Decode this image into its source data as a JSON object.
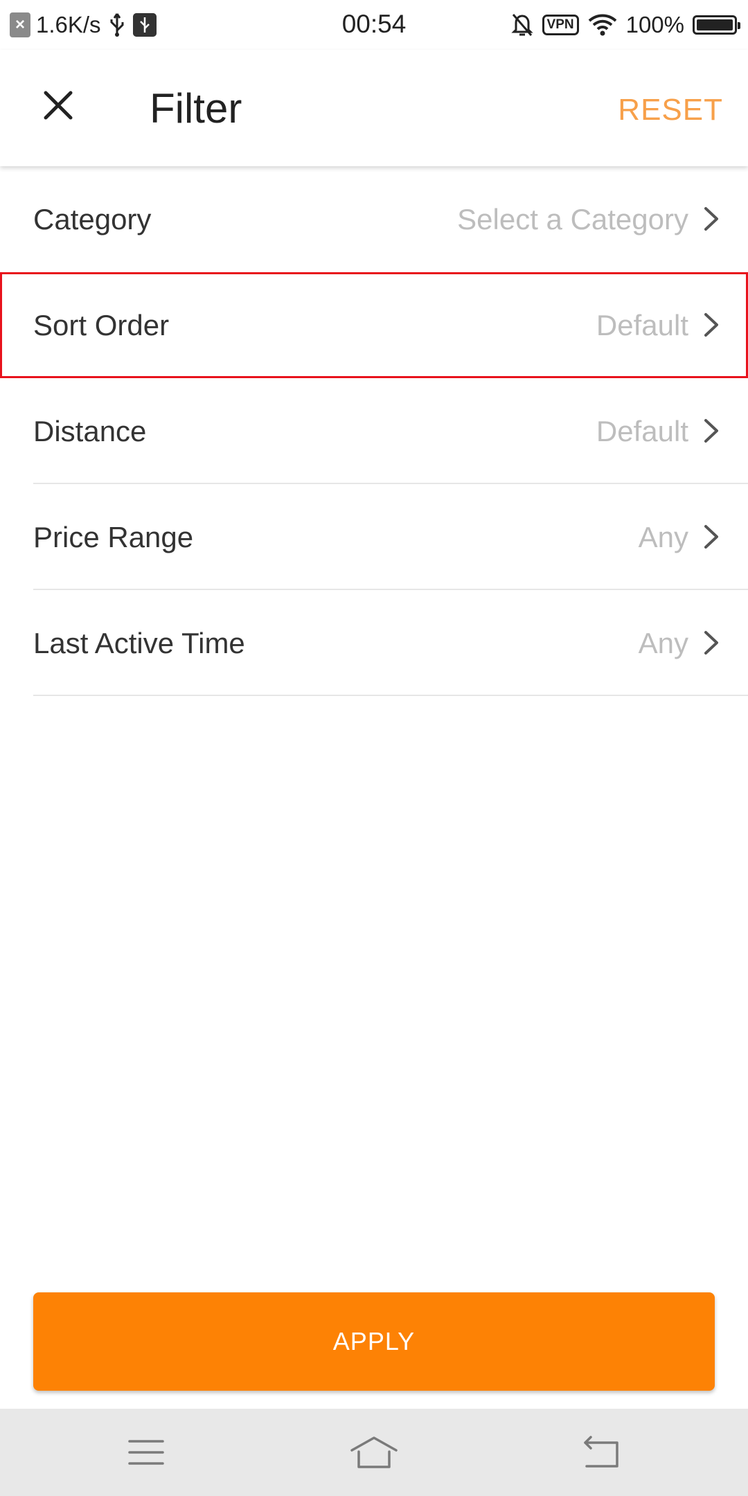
{
  "status_bar": {
    "network_speed": "1.6K/s",
    "time": "00:54",
    "vpn_label": "VPN",
    "battery_percent": "100%",
    "battery_level": 1.0,
    "icons": [
      "close-notification-icon",
      "usb-icon",
      "usb-debug-icon",
      "silent-bell-icon",
      "vpn-icon",
      "wifi-icon",
      "battery-icon"
    ]
  },
  "toolbar": {
    "title": "Filter",
    "reset_label": "RESET",
    "close_icon": "close-icon"
  },
  "filters": [
    {
      "label": "Category",
      "value": "Select a Category"
    },
    {
      "label": "Sort Order",
      "value": "Default"
    },
    {
      "label": "Distance",
      "value": "Default"
    },
    {
      "label": "Price Range",
      "value": "Any"
    },
    {
      "label": "Last Active Time",
      "value": "Any"
    }
  ],
  "apply_label": "APPLY",
  "nav_bar": {
    "icons": [
      "menu-icon",
      "home-icon",
      "back-icon"
    ]
  },
  "colors": {
    "accent": "#fd8205",
    "reset_text": "#f7a04a",
    "highlight_outline": "#e8121c",
    "value_text": "#bdbdbd"
  }
}
